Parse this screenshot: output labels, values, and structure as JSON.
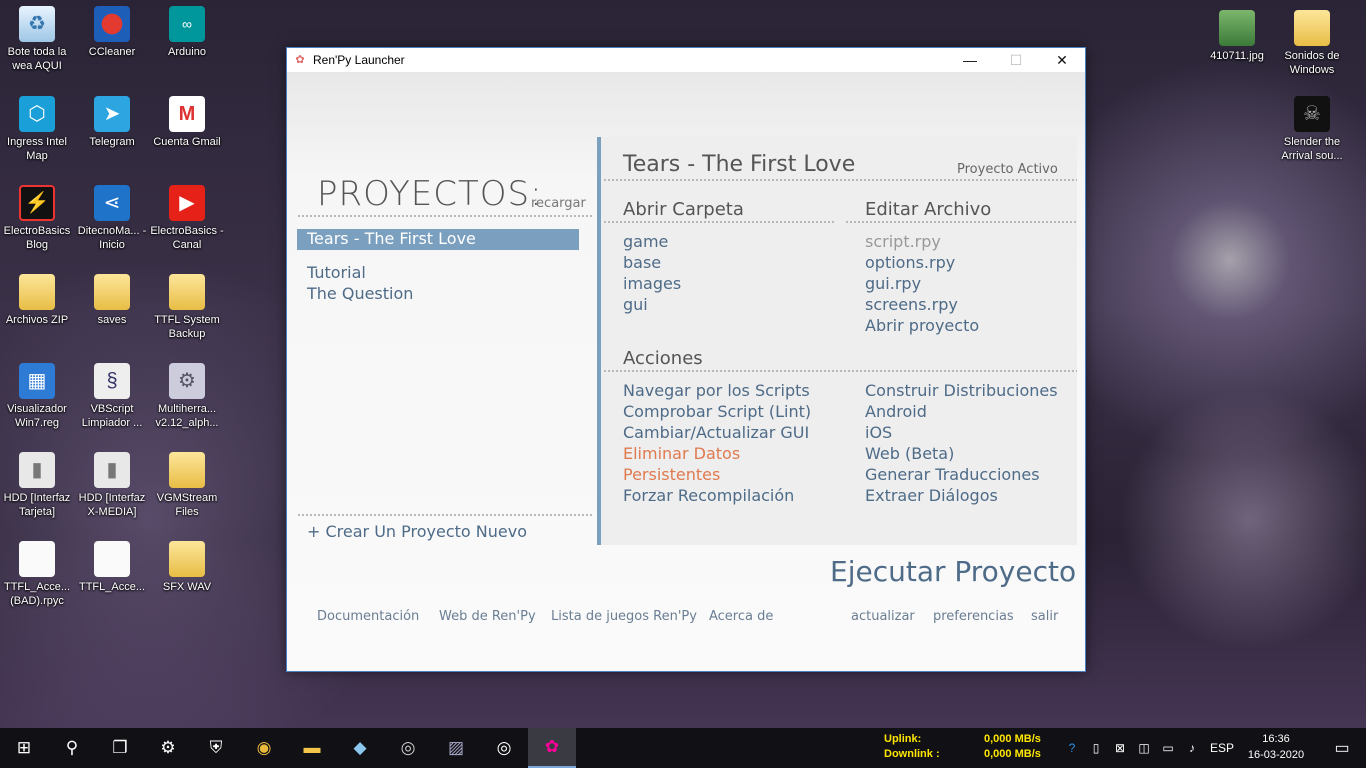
{
  "desktop": {
    "icons": [
      {
        "label": "Bote toda la wea AQUI",
        "icon": "recycle-bin-icon"
      },
      {
        "label": "CCleaner",
        "icon": "ccleaner-icon"
      },
      {
        "label": "Arduino",
        "icon": "arduino-icon"
      },
      {
        "label": "Ingress Intel Map",
        "icon": "ingress-icon"
      },
      {
        "label": "Telegram",
        "icon": "telegram-icon"
      },
      {
        "label": "Cuenta Gmail",
        "icon": "gmail-icon"
      },
      {
        "label": "ElectroBasics Blog",
        "icon": "electrobasics-icon"
      },
      {
        "label": "DitecnoMa... - Inicio",
        "icon": "share-icon"
      },
      {
        "label": "ElectroBasics - Canal",
        "icon": "youtube-icon"
      },
      {
        "label": "Archivos ZIP",
        "icon": "folder-icon"
      },
      {
        "label": "saves",
        "icon": "folder-icon"
      },
      {
        "label": "TTFL System Backup",
        "icon": "folder-icon"
      },
      {
        "label": "Visualizador Win7.reg",
        "icon": "registry-icon"
      },
      {
        "label": "VBScript Limpiador ...",
        "icon": "script-icon"
      },
      {
        "label": "Multiherra... v2.12_alph...",
        "icon": "gear-icon"
      },
      {
        "label": "HDD [Interfaz Tarjeta]",
        "icon": "drive-icon"
      },
      {
        "label": "HDD [Interfaz X-MEDIA]",
        "icon": "drive-icon"
      },
      {
        "label": "VGMStream Files",
        "icon": "folder-icon"
      },
      {
        "label": "TTFL_Acce... (BAD).rpyc",
        "icon": "file-icon"
      },
      {
        "label": "TTFL_Acce...",
        "icon": "file-icon"
      },
      {
        "label": "SFX WAV",
        "icon": "folder-icon"
      },
      {
        "label": "410711.jpg",
        "icon": "image-icon"
      },
      {
        "label": "Sonidos de Windows",
        "icon": "folder-icon"
      },
      {
        "label": "Slender the Arrival sou...",
        "icon": "slender-icon"
      }
    ]
  },
  "window": {
    "title": "Ren'Py Launcher",
    "minimize": "—",
    "maximize": "☐",
    "close": "✕"
  },
  "launcher": {
    "projects_title": "PROYECTOS:",
    "reload": "recargar",
    "projects": [
      "Tears - The First Love",
      "Tutorial",
      "The Question"
    ],
    "new_project": "+ Crear Un Proyecto Nuevo",
    "active_project": "Tears - The First Love",
    "active_label": "Proyecto Activo",
    "open_folder": {
      "title": "Abrir Carpeta",
      "items": [
        "game",
        "base",
        "images",
        "gui"
      ]
    },
    "edit_file": {
      "title": "Editar Archivo",
      "items": [
        "script.rpy",
        "options.rpy",
        "gui.rpy",
        "screens.rpy",
        "Abrir proyecto"
      ]
    },
    "actions": {
      "title": "Acciones",
      "left": [
        "Navegar por los Scripts",
        "Comprobar Script (Lint)",
        "Cambiar/Actualizar GUI",
        "Eliminar Datos",
        "Persistentes",
        "Forzar Recompilación"
      ],
      "right": [
        "Construir Distribuciones",
        "Android",
        "iOS",
        "Web (Beta)",
        "Generar Traducciones",
        "Extraer Diálogos"
      ]
    },
    "launch": "Ejecutar Proyecto",
    "footer": {
      "docs": "Documentación",
      "web": "Web de Ren'Py",
      "games": "Lista de juegos Ren'Py",
      "about": "Acerca de",
      "update": "actualizar",
      "prefs": "preferencias",
      "quit": "salir"
    }
  },
  "taskbar": {
    "uplink_label": "Uplink:",
    "downlink_label": "Downlink :",
    "uplink_value": "0,000 MB/s",
    "downlink_value": "0,000 MB/s",
    "language": "ESP",
    "time": "16:36",
    "date": "16-03-2020"
  }
}
